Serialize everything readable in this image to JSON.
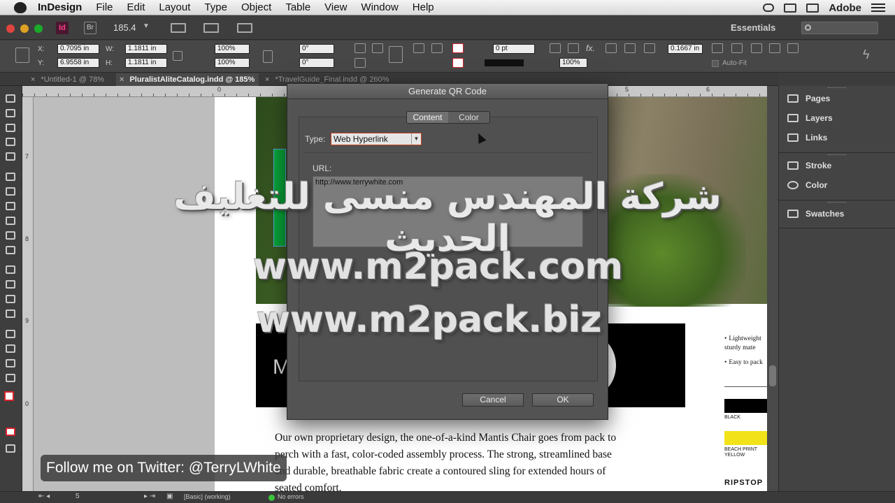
{
  "menubar": {
    "app_name": "InDesign",
    "items": [
      "File",
      "Edit",
      "Layout",
      "Type",
      "Object",
      "Table",
      "View",
      "Window",
      "Help"
    ],
    "vendor": "Adobe"
  },
  "appbar": {
    "id_badge": "Id",
    "bridge_badge": "Br",
    "zoom": "185.4",
    "workspace": "Essentials"
  },
  "control": {
    "x_label": "X:",
    "y_label": "Y:",
    "w_label": "W:",
    "h_label": "H:",
    "x": "0.7095 in",
    "y": "6.9558 in",
    "w": "1.1811 in",
    "h": "1.1811 in",
    "scale_x": "100%",
    "scale_y": "100%",
    "rotate": "0°",
    "shear": "0°",
    "stroke_weight": "0 pt",
    "opacity": "100%",
    "offset": "0.1667 in",
    "auto_fit": "Auto-Fit"
  },
  "tabs": [
    {
      "label": "*Untitled-1 @ 78%",
      "active": false
    },
    {
      "label": "PluralistAliteCatalog.indd @ 185%",
      "active": true
    },
    {
      "label": "*TravelGuide_Final.indd @ 260%",
      "active": false
    }
  ],
  "ruler": {
    "h_ticks": [
      "0",
      "5",
      "6"
    ],
    "v_ticks": [
      "7",
      "8",
      "9",
      "0"
    ]
  },
  "document": {
    "band_letter": "M",
    "body_text": "Our own proprietary design, the one-of-a-kind Mantis Chair goes from pack to perch with a fast, color-coded assembly process. The strong, streamlined base and durable, breathable fabric create a contoured sling for extended hours of seated comfort.",
    "features": [
      "Lightweight sturdy mate",
      "Easy to pack"
    ],
    "swatch_black": "BLACK",
    "swatch_yellow": "BEACH PRINT YELLOW",
    "ripstop": "RIPSTOP"
  },
  "panels": {
    "items": [
      {
        "label": "Pages",
        "icon": "pages-icon"
      },
      {
        "label": "Layers",
        "icon": "layers-icon"
      },
      {
        "label": "Links",
        "icon": "links-icon"
      },
      {
        "label": "Stroke",
        "icon": "stroke-icon"
      },
      {
        "label": "Color",
        "icon": "color-icon"
      },
      {
        "label": "Swatches",
        "icon": "swatches-icon"
      }
    ]
  },
  "status": {
    "page": "5",
    "profile": "[Basic] (working)",
    "errors": "No errors"
  },
  "dialog": {
    "title": "Generate QR Code",
    "tab_content": "Content",
    "tab_color": "Color",
    "type_label": "Type:",
    "type_value": "Web Hyperlink",
    "url_label": "URL:",
    "url_value": "http://www.terrywhite.com",
    "cancel": "Cancel",
    "ok": "OK"
  },
  "overlay": {
    "watermark_arabic": "شركة المهندس منسى للتغليف الحديث",
    "watermark_com": "www.m2pack.com",
    "watermark_biz": "www.m2pack.biz",
    "follow": "Follow me on Twitter: @TerryLWhite"
  }
}
